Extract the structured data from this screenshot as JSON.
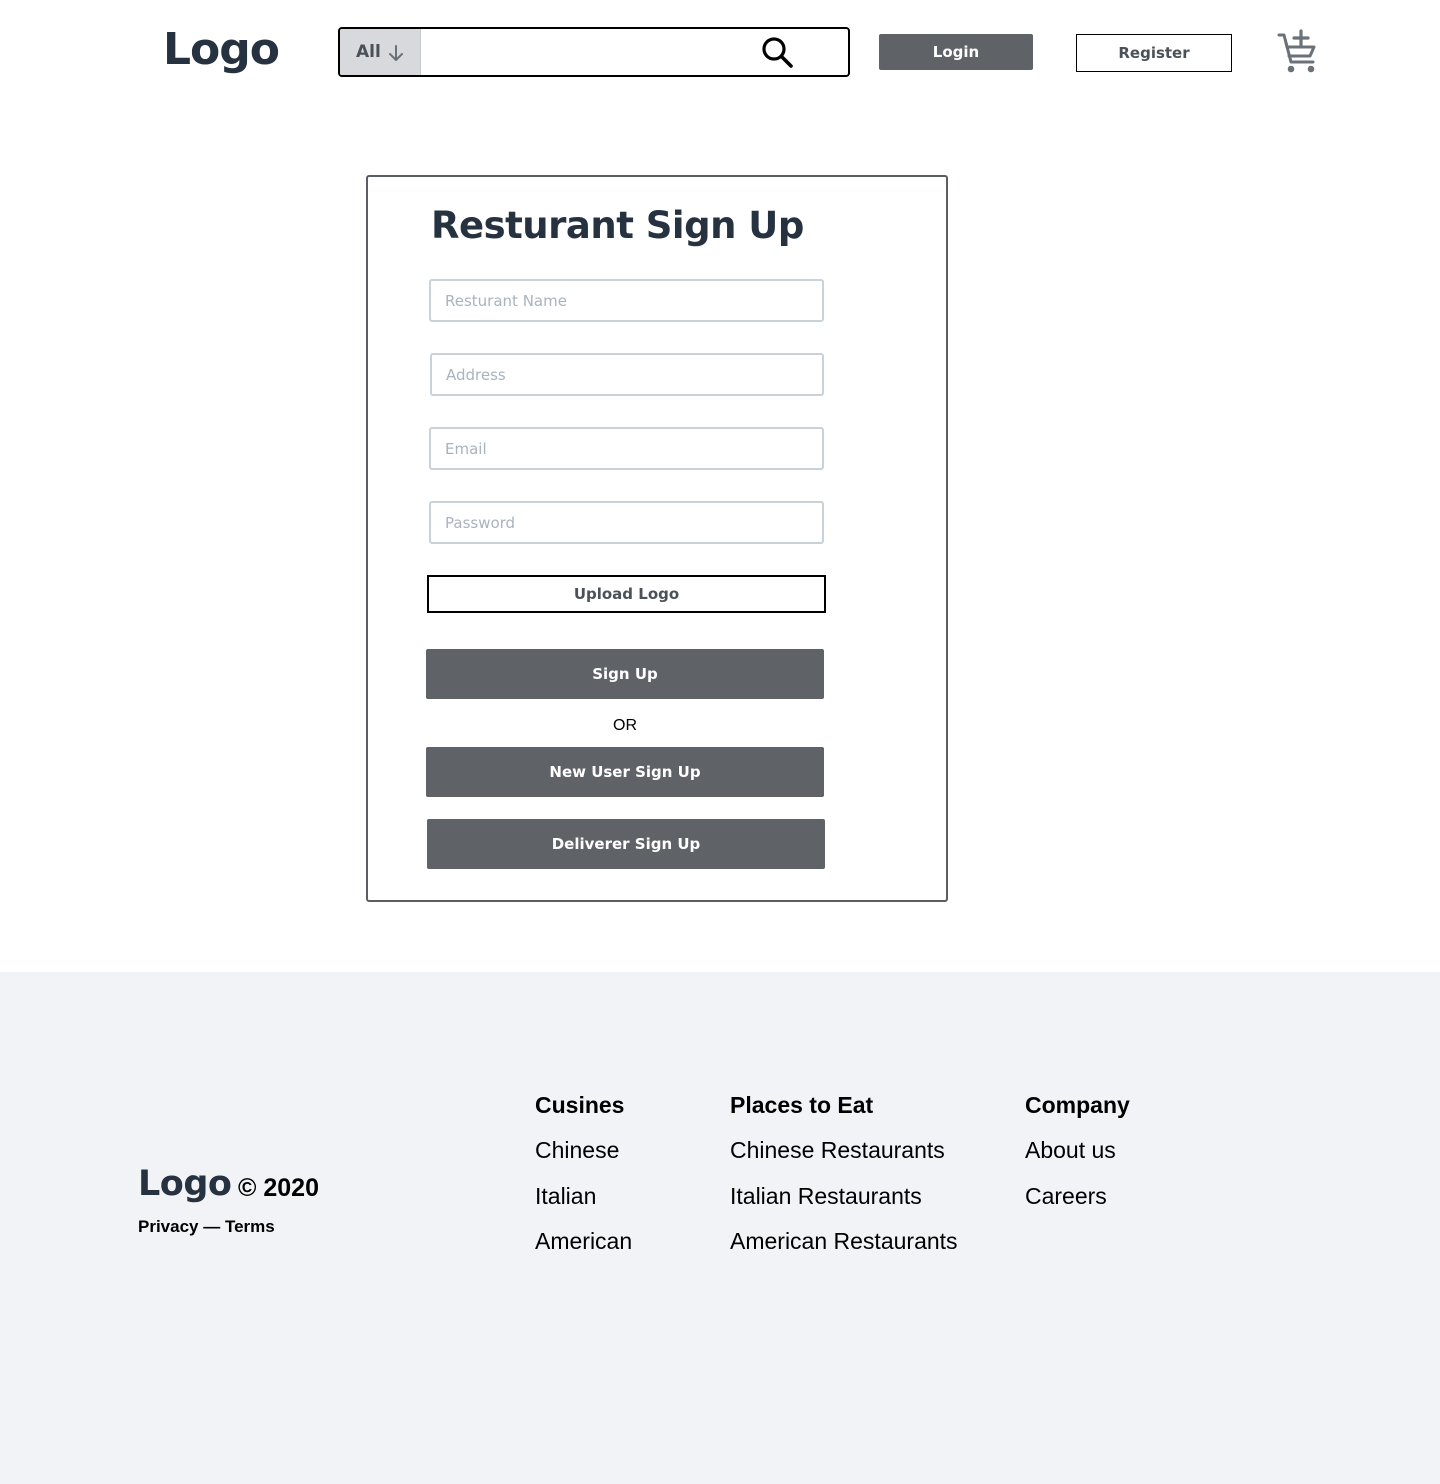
{
  "header": {
    "logo": "Logo",
    "search": {
      "category": "All",
      "placeholder": ""
    },
    "login_label": "Login",
    "register_label": "Register",
    "icons": {
      "category_dropdown": "arrow-down-icon",
      "search": "search-icon",
      "cart": "cart-add-icon"
    }
  },
  "signup": {
    "title": "Resturant Sign Up",
    "fields": {
      "restaurant_name": "Resturant Name",
      "address": "Address",
      "email": "Email",
      "password": "Password"
    },
    "upload_label": "Upload Logo",
    "signup_label": "Sign Up",
    "or_label": "OR",
    "new_user_label": "New User Sign Up",
    "deliverer_label": "Deliverer Sign Up"
  },
  "footer": {
    "logo": "Logo",
    "copyright": "© 2020",
    "legal": "Privacy — Terms",
    "columns": [
      {
        "title": "Cusines",
        "links": [
          "Chinese",
          "Italian",
          "American"
        ]
      },
      {
        "title": "Places to Eat",
        "links": [
          "Chinese Restaurants",
          "Italian Restaurants",
          "American Restaurants"
        ]
      },
      {
        "title": "Company",
        "links": [
          "About us",
          "Careers"
        ]
      }
    ]
  },
  "colors": {
    "button_dark": "#5f6266",
    "heading": "#273240",
    "footer_bg": "#f2f3f7",
    "field_border": "#c9d1d9",
    "placeholder": "#a8b3bf"
  }
}
